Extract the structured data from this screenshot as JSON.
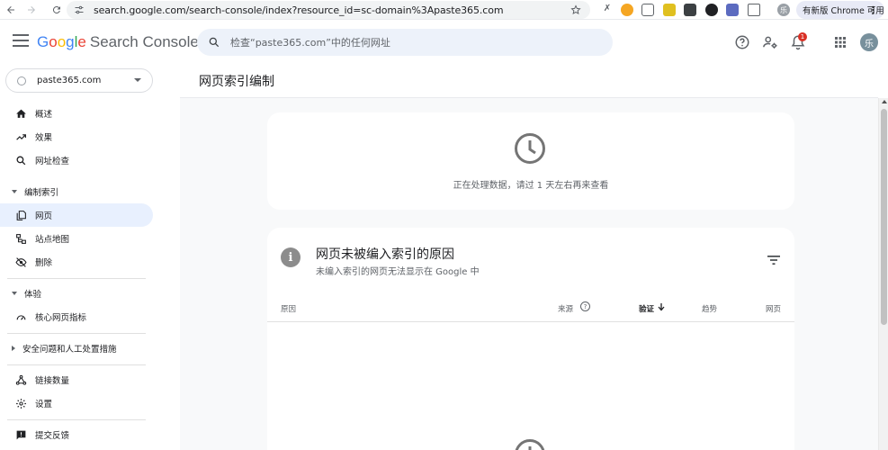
{
  "browser": {
    "url": "search.google.com/search-console/index?resource_id=sc-domain%3Apaste365.com",
    "update_label": "有新版 Chrome 可用",
    "profile_initial": "乐"
  },
  "header": {
    "logo_google": [
      "G",
      "o",
      "o",
      "g",
      "l",
      "e"
    ],
    "logo_product": "Search Console",
    "search_placeholder": "检查“paste365.com”中的任何网址",
    "notification_count": "1",
    "avatar_initial": "乐"
  },
  "sidebar": {
    "property": "paste365.com",
    "items": [
      {
        "label": "概述",
        "icon": "home-icon"
      },
      {
        "label": "效果",
        "icon": "trending-up-icon"
      },
      {
        "label": "网址检查",
        "icon": "search-icon"
      }
    ],
    "section_indexing": "编制索引",
    "indexing_items": [
      {
        "label": "网页",
        "icon": "pages-icon"
      },
      {
        "label": "站点地图",
        "icon": "sitemap-icon"
      },
      {
        "label": "删除",
        "icon": "visibility-off-icon"
      }
    ],
    "section_experience": "体验",
    "experience_items": [
      {
        "label": "核心网页指标",
        "icon": "speed-icon"
      }
    ],
    "section_security": "安全问题和人工处置措施",
    "bottom_items": [
      {
        "label": "链接数量",
        "icon": "links-icon"
      },
      {
        "label": "设置",
        "icon": "settings-icon"
      },
      {
        "label": "提交反馈",
        "icon": "feedback-icon"
      }
    ]
  },
  "main": {
    "page_title": "网页索引编制",
    "processing_message": "正在处理数据，请过 1 天左右再来查看",
    "reasons_card": {
      "title": "网页未被编入索引的原因",
      "subtitle": "未编入索引的网页无法显示在 Google 中",
      "columns": [
        "原因",
        "来源",
        "验证",
        "趋势",
        "网页"
      ]
    }
  }
}
